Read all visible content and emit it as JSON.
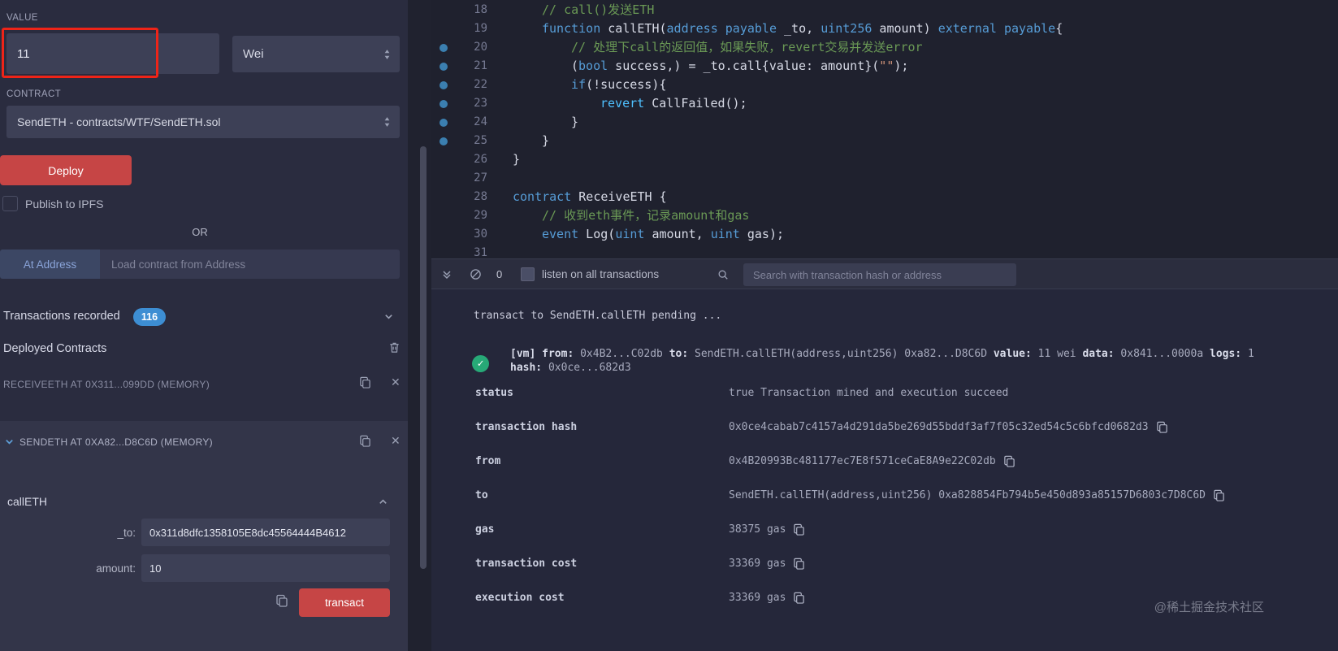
{
  "icons": {
    "close": "✕",
    "check": "✓"
  },
  "sidebar": {
    "value_label": "VALUE",
    "value_input": "11",
    "unit_select": "Wei",
    "contract_label": "CONTRACT",
    "contract_select": "SendETH - contracts/WTF/SendETH.sol",
    "deploy_button": "Deploy",
    "publish_checkbox_label": "Publish to IPFS",
    "or_label": "OR",
    "at_address_button": "At Address",
    "at_address_placeholder": "Load contract from Address",
    "transactions_recorded_label": "Transactions recorded",
    "transactions_count": "116",
    "deployed_contracts_label": "Deployed Contracts",
    "receiveeth_item_label": "RECEIVEETH AT 0X311...099DD (MEMORY)",
    "sendeth_item_label": "SENDETH AT 0XA82...D8C6D (MEMORY)",
    "calleth_function_label": "callETH",
    "to_label": "_to:",
    "to_value": "0x311d8dfc1358105E8dc45564444B4612",
    "amount_label": "amount:",
    "amount_value": "10",
    "transact_button": "transact"
  },
  "editor": {
    "lines": [
      {
        "num": "18",
        "dot": false,
        "indent": 1,
        "tokens": [
          [
            "// call()发送ETH",
            "cm"
          ]
        ]
      },
      {
        "num": "19",
        "dot": false,
        "indent": 1,
        "tokens": [
          [
            "function ",
            "kw"
          ],
          [
            "callETH(",
            "pl"
          ],
          [
            "address",
            "kw"
          ],
          [
            " ",
            "pl"
          ],
          [
            "payable",
            "kw"
          ],
          [
            " _to, ",
            "pl"
          ],
          [
            "uint256",
            "kw"
          ],
          [
            " amount) ",
            "pl"
          ],
          [
            "external",
            "kw"
          ],
          [
            " ",
            "pl"
          ],
          [
            "payable",
            "kw"
          ],
          [
            "{",
            "pl"
          ]
        ]
      },
      {
        "num": "20",
        "dot": true,
        "indent": 2,
        "tokens": [
          [
            "// 处理下call的返回值，如果失败，revert交易并发送error",
            "cm"
          ]
        ]
      },
      {
        "num": "21",
        "dot": true,
        "indent": 2,
        "tokens": [
          [
            "(",
            "pl"
          ],
          [
            "bool",
            "kw"
          ],
          [
            " success,) = _to.call{value: amount}(",
            "pl"
          ],
          [
            "\"\"",
            "st"
          ],
          [
            ");",
            "pl"
          ]
        ]
      },
      {
        "num": "22",
        "dot": true,
        "indent": 2,
        "tokens": [
          [
            "if",
            "kw"
          ],
          [
            "(!success){",
            "pl"
          ]
        ]
      },
      {
        "num": "23",
        "dot": true,
        "indent": 3,
        "tokens": [
          [
            "revert",
            "cy"
          ],
          [
            " CallFailed();",
            "pl"
          ]
        ]
      },
      {
        "num": "24",
        "dot": true,
        "indent": 2,
        "tokens": [
          [
            "}",
            "pl"
          ]
        ]
      },
      {
        "num": "25",
        "dot": true,
        "indent": 1,
        "tokens": [
          [
            "}",
            "pl"
          ]
        ]
      },
      {
        "num": "26",
        "dot": false,
        "indent": 0,
        "tokens": [
          [
            "}",
            "pl"
          ]
        ]
      },
      {
        "num": "27",
        "dot": false,
        "indent": 0,
        "tokens": []
      },
      {
        "num": "28",
        "dot": false,
        "indent": 0,
        "tokens": [
          [
            "contract",
            "kw"
          ],
          [
            " ReceiveETH {",
            "pl"
          ]
        ]
      },
      {
        "num": "29",
        "dot": false,
        "indent": 1,
        "tokens": [
          [
            "// 收到eth事件，记录amount和gas",
            "cm"
          ]
        ]
      },
      {
        "num": "30",
        "dot": false,
        "indent": 1,
        "tokens": [
          [
            "event",
            "kw"
          ],
          [
            " Log(",
            "pl"
          ],
          [
            "uint",
            "kw"
          ],
          [
            " amount, ",
            "pl"
          ],
          [
            "uint",
            "kw"
          ],
          [
            " gas);",
            "pl"
          ]
        ]
      },
      {
        "num": "31",
        "dot": false,
        "indent": 0,
        "tokens": []
      }
    ]
  },
  "terminal": {
    "pending_count": "0",
    "listen_checkbox_label": "listen on all transactions",
    "search_placeholder": "Search with transaction hash or address",
    "pending_line": "transact to SendETH.callETH pending ... ",
    "log_line1": [
      [
        "[vm]",
        1
      ],
      [
        " from:",
        1
      ],
      [
        " 0x4B2...C02db ",
        0
      ],
      [
        "to:",
        1
      ],
      [
        " SendETH.callETH(address,uint256) 0xa82...D8C6D ",
        0
      ],
      [
        "value:",
        1
      ],
      [
        " 11 wei ",
        0
      ],
      [
        "data:",
        1
      ],
      [
        " 0x841...0000a ",
        0
      ],
      [
        "logs:",
        1
      ],
      [
        " 1",
        0
      ]
    ],
    "log_line2": [
      [
        "hash:",
        1
      ],
      [
        " 0x0ce...682d3",
        0
      ]
    ],
    "receipt_rows": [
      {
        "label": "status",
        "value": "true Transaction mined and execution succeed",
        "copy": false
      },
      {
        "label": "transaction hash",
        "value": "0x0ce4cabab7c4157a4d291da5be269d55bddf3af7f05c32ed54c5c6bfcd0682d3",
        "copy": true
      },
      {
        "label": "from",
        "value": "0x4B20993Bc481177ec7E8f571ceCaE8A9e22C02db",
        "copy": true
      },
      {
        "label": "to",
        "value": "SendETH.callETH(address,uint256) 0xa828854Fb794b5e450d893a85157D6803c7D8C6D",
        "copy": true
      },
      {
        "label": "gas",
        "value": "38375 gas",
        "copy": true
      },
      {
        "label": "transaction cost",
        "value": "33369 gas",
        "copy": true
      },
      {
        "label": "execution cost",
        "value": "33369 gas",
        "copy": true
      }
    ]
  },
  "watermark": "@稀土掘金技术社区"
}
